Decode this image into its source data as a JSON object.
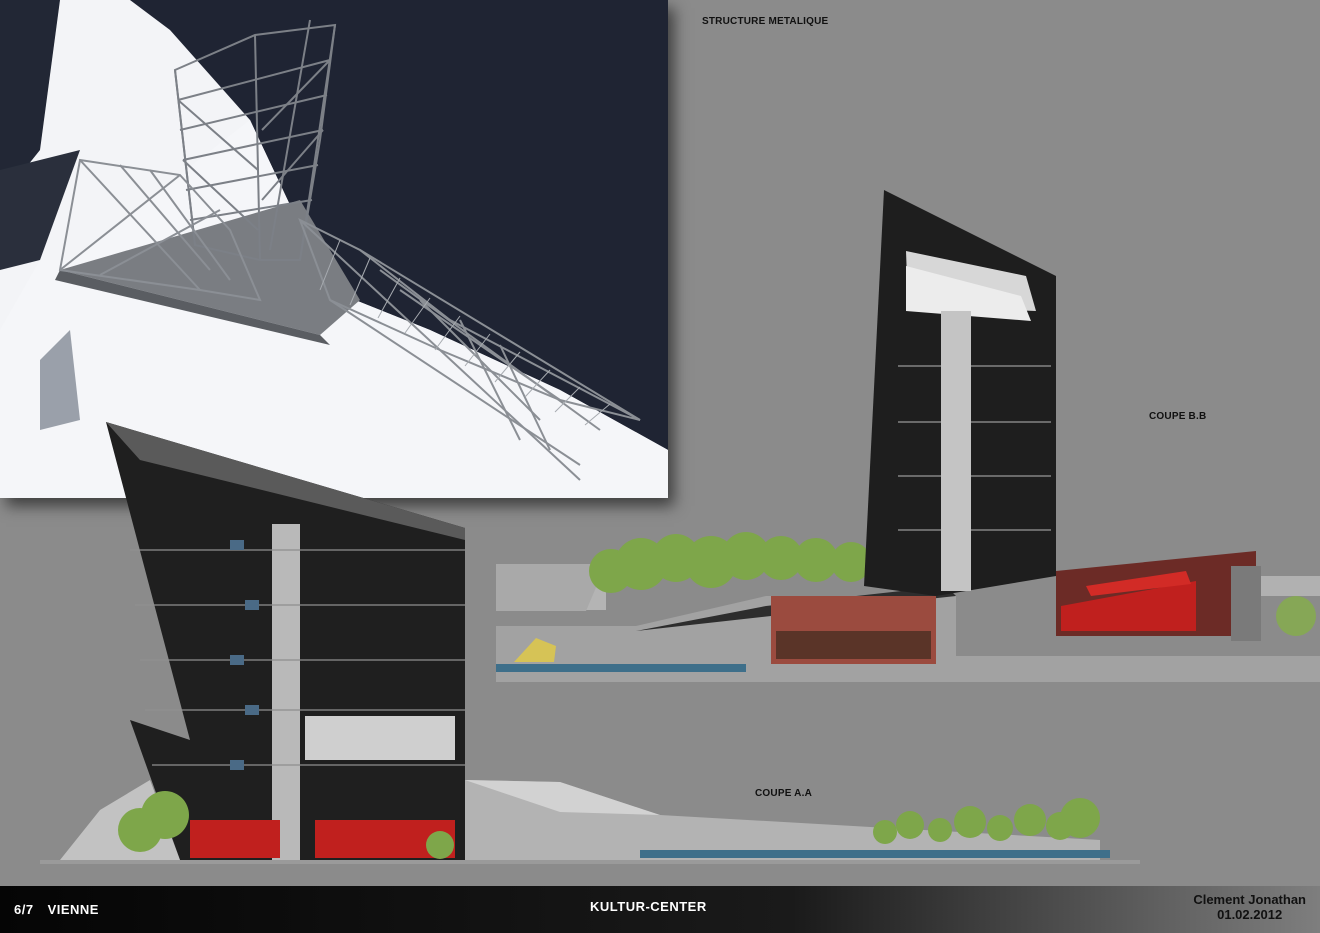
{
  "labels": {
    "structure": "STRUCTURE METALIQUE",
    "coupe_bb": "COUPE B.B",
    "coupe_aa": "COUPE A.A"
  },
  "footer": {
    "page": "6/7",
    "city": "VIENNE",
    "project": "KULTUR-CENTER",
    "author": "Clement Jonathan",
    "date": "01.02.2012"
  },
  "colors": {
    "board": "#8b8b8b",
    "water": "#1f2433",
    "seat_red": "#c0201e",
    "glass": "#2a2a2a",
    "foliage": "#7ea64a"
  }
}
